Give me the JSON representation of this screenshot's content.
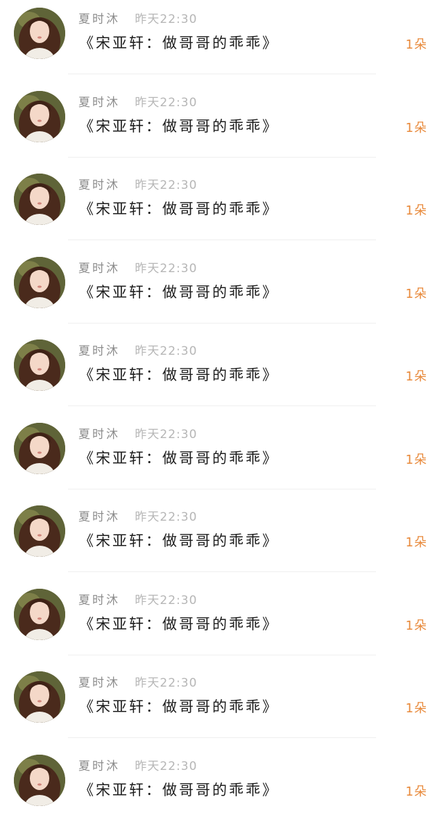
{
  "items": [
    {
      "author": "夏时沐",
      "time": "昨天22:30",
      "title": "《宋亚轩：做哥哥的乖乖》",
      "count": "1朵",
      "avatar": "avatar"
    },
    {
      "author": "夏时沐",
      "time": "昨天22:30",
      "title": "《宋亚轩：做哥哥的乖乖》",
      "count": "1朵",
      "avatar": "avatar"
    },
    {
      "author": "夏时沐",
      "time": "昨天22:30",
      "title": "《宋亚轩：做哥哥的乖乖》",
      "count": "1朵",
      "avatar": "avatar"
    },
    {
      "author": "夏时沐",
      "time": "昨天22:30",
      "title": "《宋亚轩：做哥哥的乖乖》",
      "count": "1朵",
      "avatar": "avatar"
    },
    {
      "author": "夏时沐",
      "time": "昨天22:30",
      "title": "《宋亚轩：做哥哥的乖乖》",
      "count": "1朵",
      "avatar": "avatar"
    },
    {
      "author": "夏时沐",
      "time": "昨天22:30",
      "title": "《宋亚轩：做哥哥的乖乖》",
      "count": "1朵",
      "avatar": "avatar"
    },
    {
      "author": "夏时沐",
      "time": "昨天22:30",
      "title": "《宋亚轩：做哥哥的乖乖》",
      "count": "1朵",
      "avatar": "avatar"
    },
    {
      "author": "夏时沐",
      "time": "昨天22:30",
      "title": "《宋亚轩：做哥哥的乖乖》",
      "count": "1朵",
      "avatar": "avatar"
    },
    {
      "author": "夏时沐",
      "time": "昨天22:30",
      "title": "《宋亚轩：做哥哥的乖乖》",
      "count": "1朵",
      "avatar": "avatar"
    },
    {
      "author": "夏时沐",
      "time": "昨天22:30",
      "title": "《宋亚轩：做哥哥的乖乖》",
      "count": "1朵",
      "avatar": "avatar"
    }
  ],
  "colors": {
    "author": "#8d8d8d",
    "time": "#b6b6b6",
    "title": "#1c1c1c",
    "count_accent": "#e8893a",
    "divider": "#efefef"
  }
}
